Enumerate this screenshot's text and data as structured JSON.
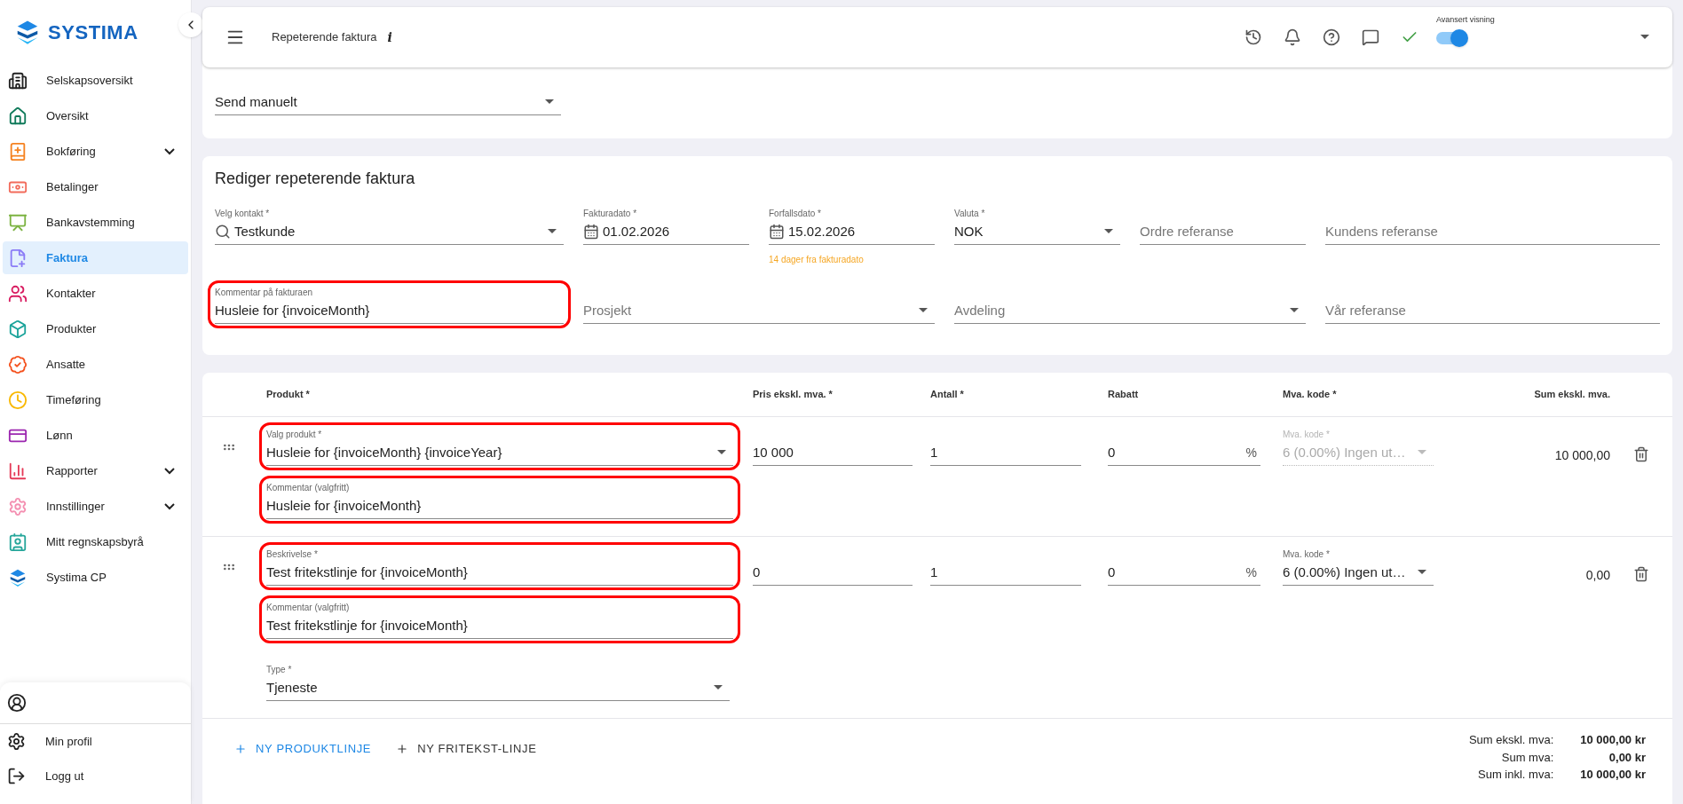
{
  "sidebar": {
    "logo": "SYSTIMA",
    "items": [
      {
        "label": "Selskapsoversikt",
        "selected": false
      },
      {
        "label": "Oversikt",
        "selected": false
      },
      {
        "label": "Bokføring",
        "selected": false,
        "expandable": true
      },
      {
        "label": "Betalinger",
        "selected": false
      },
      {
        "label": "Bankavstemming",
        "selected": false
      },
      {
        "label": "Faktura",
        "selected": true
      },
      {
        "label": "Kontakter",
        "selected": false
      },
      {
        "label": "Produkter",
        "selected": false
      },
      {
        "label": "Ansatte",
        "selected": false
      },
      {
        "label": "Timeføring",
        "selected": false
      },
      {
        "label": "Lønn",
        "selected": false
      },
      {
        "label": "Rapporter",
        "selected": false,
        "expandable": true
      },
      {
        "label": "Innstillinger",
        "selected": false,
        "expandable": true
      },
      {
        "label": "Mitt regnskapsbyrå",
        "selected": false
      },
      {
        "label": "Systima CP",
        "selected": false
      }
    ],
    "bottom_items": [
      {
        "label": "Min profil"
      },
      {
        "label": "Logg ut"
      }
    ]
  },
  "header": {
    "title": "Repeterende faktura",
    "info": "i",
    "toggle": {
      "label": "Avansert visning",
      "on": true
    }
  },
  "send_field": {
    "kind": "select",
    "value": "Send manuelt"
  },
  "form": {
    "title": "Rediger repeterende faktura",
    "fields": [
      {
        "kind": "search",
        "label": "Velg kontakt *",
        "value": "Testkunde",
        "highlighted": false
      },
      {
        "kind": "date",
        "label": "Fakturadato *",
        "value": "01.02.2026",
        "highlighted": false
      },
      {
        "kind": "date",
        "label": "Forfallsdato *",
        "value": "15.02.2026",
        "helper": "14 dager fra fakturadato",
        "highlighted": false
      },
      {
        "kind": "select",
        "label": "Valuta *",
        "value": "NOK",
        "highlighted": false
      },
      {
        "kind": "text",
        "placeholder": "Ordre referanse",
        "highlighted": false
      },
      {
        "kind": "text",
        "placeholder": "Kundens referanse",
        "highlighted": false
      },
      {
        "kind": "text",
        "label": "Kommentar på fakturaen",
        "value": "Husleie for {invoiceMonth}",
        "highlighted": true
      },
      {
        "kind": "select",
        "placeholder": "Prosjekt",
        "highlighted": false
      },
      {
        "kind": "select",
        "placeholder": "Avdeling",
        "highlighted": false
      },
      {
        "kind": "text",
        "placeholder": "Vår referanse",
        "highlighted": false
      }
    ]
  },
  "table": {
    "columns": [
      "Produkt *",
      "Pris ekskl. mva. *",
      "Antall *",
      "Rabatt",
      "Mva. kode *",
      "Sum ekskl. mva."
    ],
    "rows": [
      {
        "main": [
          {
            "kind": "select",
            "label": "Valg produkt *",
            "value": "Husleie for {invoiceMonth} {invoiceYear}",
            "highlighted": true
          },
          {
            "kind": "text",
            "label": "Kommentar (valgfritt)",
            "value": "Husleie for {invoiceMonth}",
            "highlighted": true
          }
        ],
        "price": "10 000",
        "quantity": "1",
        "discount": "0",
        "discount_unit": "%",
        "vat": {
          "label": "Mva. kode *",
          "value": "6 (0.00%) Ingen ut…",
          "disabled": true
        },
        "sum": "10 000,00"
      },
      {
        "main": [
          {
            "kind": "text",
            "label": "Beskrivelse *",
            "value": "Test fritekstlinje for {invoiceMonth}",
            "highlighted": true
          },
          {
            "kind": "text",
            "label": "Kommentar (valgfritt)",
            "value": "Test fritekstlinje for {invoiceMonth}",
            "highlighted": true
          },
          {
            "kind": "select",
            "label": "Type *",
            "value": "Tjeneste",
            "highlighted": false
          }
        ],
        "price": "0",
        "quantity": "1",
        "discount": "0",
        "discount_unit": "%",
        "vat": {
          "label": "Mva. kode *",
          "value": "6 (0.00%) Ingen ut…",
          "disabled": false
        },
        "sum": "0,00"
      }
    ]
  },
  "actions": [
    {
      "label": "NY PRODUKTLINJE",
      "primary": true
    },
    {
      "label": "NY FRITEKST-LINJE",
      "primary": false
    }
  ],
  "totals": [
    {
      "label": "Sum ekskl. mva:",
      "value": "10 000,00 kr"
    },
    {
      "label": "Sum mva:",
      "value": "0,00 kr"
    },
    {
      "label": "Sum inkl. mva:",
      "value": "10 000,00 kr"
    }
  ]
}
